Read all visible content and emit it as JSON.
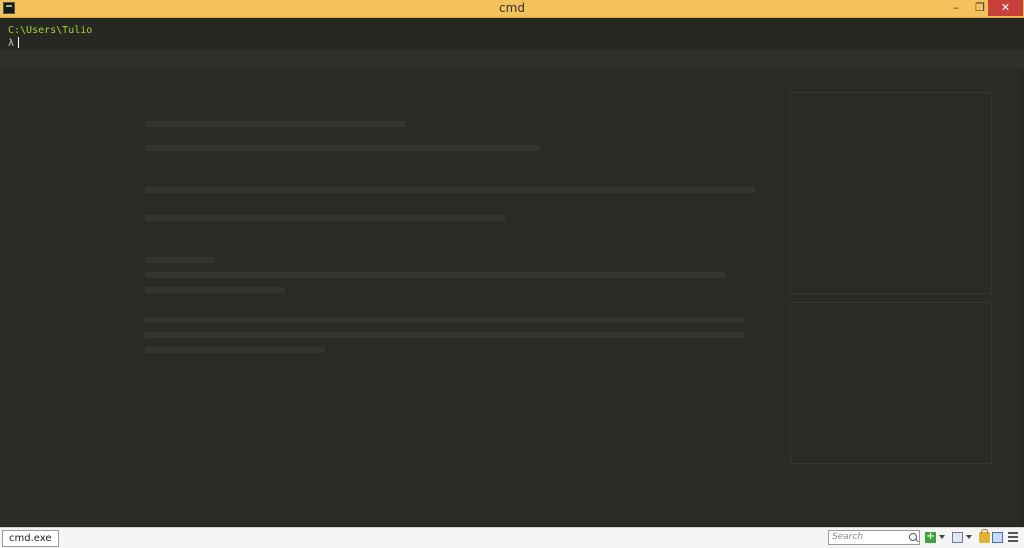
{
  "window": {
    "title": "cmd",
    "controls": {
      "minimize": "–",
      "maximize": "❐",
      "close": "✕"
    }
  },
  "terminal": {
    "path": "C:\\Users\\Tulio",
    "prompt": "λ"
  },
  "statusbar": {
    "tab_label": "cmd.exe",
    "search_placeholder": "Search",
    "add_label": "+"
  },
  "colors": {
    "titlebar": "#f3c25a",
    "close_button": "#c7413a",
    "terminal_bg": "#272822",
    "prompt_path": "#a6d13a"
  }
}
